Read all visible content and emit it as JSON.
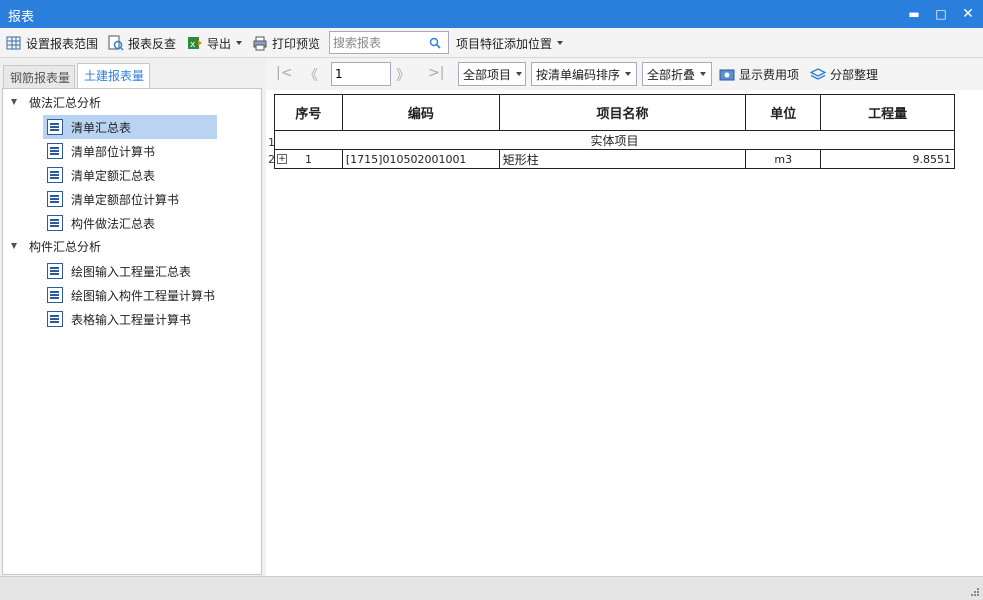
{
  "window": {
    "title": "报表",
    "min": "▬",
    "max": "□",
    "close": "✕"
  },
  "toolbar": {
    "set_range": "设置报表范围",
    "reverse_check": "报表反查",
    "export": "导出",
    "print_preview": "打印预览",
    "search_placeholder": "搜索报表",
    "feature_position": "项目特征添加位置"
  },
  "left_tabs": {
    "rebar": "钢筋报表量",
    "civil": "土建报表量"
  },
  "tree": [
    {
      "label": "做法汇总分析",
      "children": [
        "清单汇总表",
        "清单部位计算书",
        "清单定额汇总表",
        "清单定额部位计算书",
        "构件做法汇总表"
      ]
    },
    {
      "label": "构件汇总分析",
      "children": [
        "绘图输入工程量汇总表",
        "绘图输入构件工程量计算书",
        "表格输入工程量计算书"
      ]
    }
  ],
  "pager": {
    "page": "1",
    "first": "|<",
    "prev": "《",
    "next": "》",
    "last": ">|"
  },
  "filters": {
    "items": "全部项目",
    "sort": "按清单编码排序",
    "fold": "全部折叠",
    "show_fee": "显示费用项",
    "organize": "分部整理"
  },
  "table": {
    "headers": [
      "序号",
      "编码",
      "项目名称",
      "单位",
      "工程量"
    ],
    "group_row": {
      "row_no": "1",
      "label": "实体项目"
    },
    "rows": [
      {
        "row_no": "2",
        "expander": "+",
        "seq": "1",
        "code": "[1715]010502001001",
        "name": "矩形柱",
        "unit": "m3",
        "qty": "9.8551"
      }
    ]
  }
}
